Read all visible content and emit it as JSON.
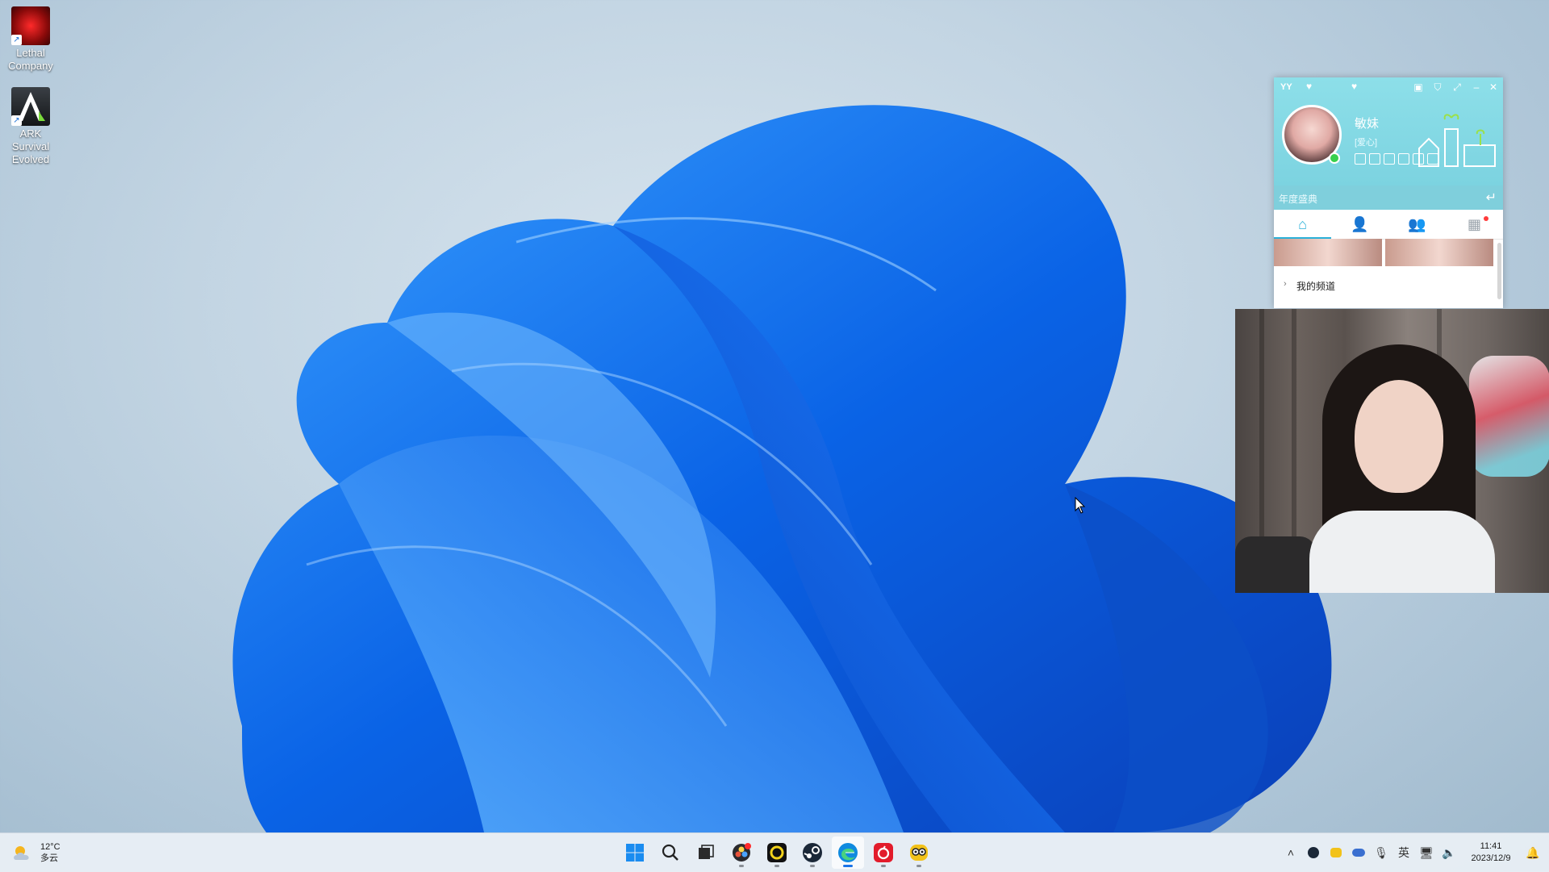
{
  "desktop": {
    "icons": [
      {
        "label": "Lethal Company",
        "icon": "lethal-company-icon"
      },
      {
        "label": "ARK Survival Evolved",
        "icon": "ark-survival-icon"
      }
    ]
  },
  "yy_window": {
    "logo": "YY",
    "nickname": "敏妹",
    "signature": "[爱心]",
    "subbar_text": "年度盛典",
    "tabs": [
      "home-tab",
      "contacts-tab",
      "friends-tab",
      "apps-tab"
    ],
    "channel_label": "我的频道",
    "colors": {
      "header": "#7cd3e0",
      "accent": "#2ab0d8"
    }
  },
  "taskbar": {
    "weather": {
      "temp": "12°C",
      "condition": "多云"
    },
    "apps": [
      "start",
      "search",
      "task-view",
      "davinci",
      "app-circle",
      "steam",
      "edge",
      "netease-music",
      "game-helper"
    ],
    "input_method": "英",
    "clock": {
      "time": "11:41",
      "date": "2023/12/9"
    }
  }
}
